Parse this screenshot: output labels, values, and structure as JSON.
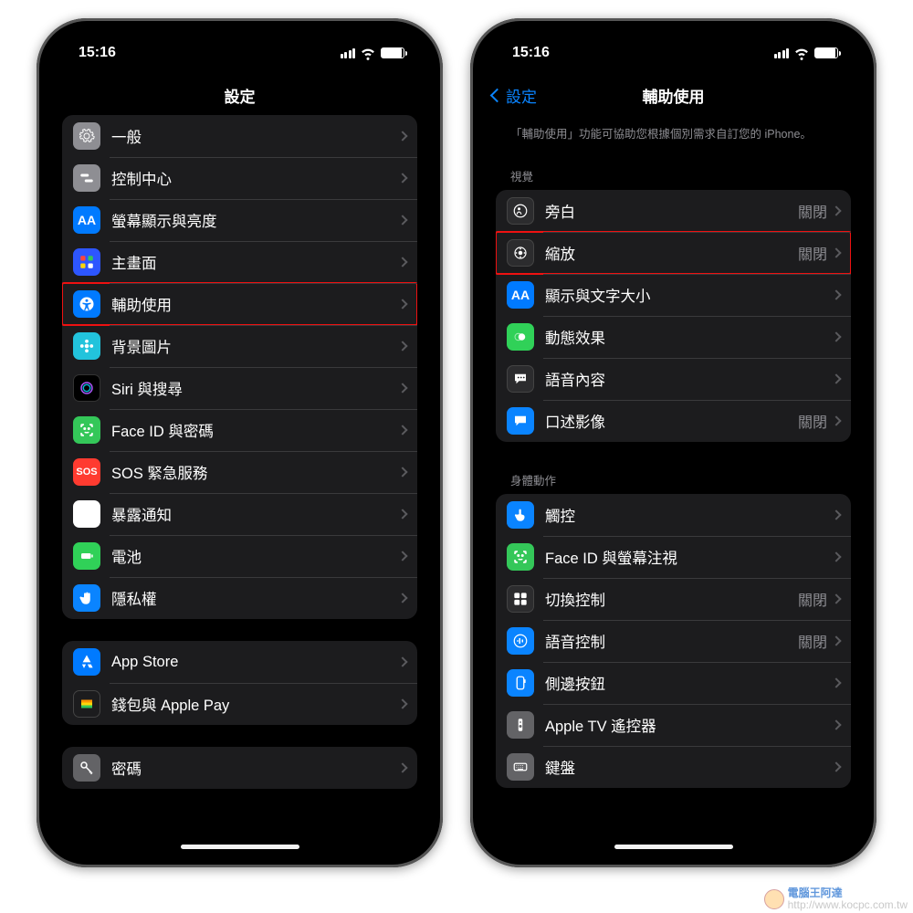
{
  "status": {
    "time": "15:16"
  },
  "left": {
    "title": "設定",
    "groups": [
      {
        "rows": [
          {
            "icon": "gear-icon",
            "label": "一般",
            "bg": "bg-gray"
          },
          {
            "icon": "switches-icon",
            "label": "控制中心",
            "bg": "bg-gray"
          },
          {
            "icon": "text-size-icon",
            "label": "螢幕顯示與亮度",
            "bg": "bg-blue"
          },
          {
            "icon": "grid-icon",
            "label": "主畫面",
            "bg": "bg-grid"
          },
          {
            "icon": "accessibility-icon",
            "label": "輔助使用",
            "bg": "bg-access",
            "highlight": true
          },
          {
            "icon": "flower-icon",
            "label": "背景圖片",
            "bg": "bg-teal"
          },
          {
            "icon": "siri-icon",
            "label": "Siri 與搜尋",
            "bg": "bg-black"
          },
          {
            "icon": "faceid-icon",
            "label": "Face ID 與密碼",
            "bg": "bg-green"
          },
          {
            "icon": "sos-icon",
            "label": "SOS 緊急服務",
            "bg": "bg-red",
            "text": "SOS"
          },
          {
            "icon": "exposure-icon",
            "label": "暴露通知",
            "bg": "bg-redw"
          },
          {
            "icon": "battery-icon",
            "label": "電池",
            "bg": "bg-green2"
          },
          {
            "icon": "hand-icon",
            "label": "隱私權",
            "bg": "bg-blue2"
          }
        ]
      },
      {
        "rows": [
          {
            "icon": "appstore-icon",
            "label": "App Store",
            "bg": "bg-blue"
          },
          {
            "icon": "wallet-icon",
            "label": "錢包與 Apple Pay",
            "bg": "bg-wall"
          }
        ]
      },
      {
        "rows": [
          {
            "icon": "key-icon",
            "label": "密碼",
            "bg": "bg-gray2"
          }
        ]
      }
    ]
  },
  "right": {
    "back": "設定",
    "title": "輔助使用",
    "desc": "「輔助使用」功能可協助您根據個別需求自訂您的 iPhone。",
    "sections": [
      {
        "header": "視覺",
        "rows": [
          {
            "icon": "voiceover-icon",
            "label": "旁白",
            "value": "關閉",
            "bg": "bg-dark"
          },
          {
            "icon": "zoom-icon",
            "label": "縮放",
            "value": "關閉",
            "bg": "bg-dark",
            "highlight": true
          },
          {
            "icon": "text-size-icon",
            "label": "顯示與文字大小",
            "bg": "bg-blue"
          },
          {
            "icon": "motion-icon",
            "label": "動態效果",
            "bg": "bg-green2"
          },
          {
            "icon": "speech-icon",
            "label": "語音內容",
            "bg": "bg-dark"
          },
          {
            "icon": "audio-desc-icon",
            "label": "口述影像",
            "value": "關閉",
            "bg": "bg-blue2"
          }
        ]
      },
      {
        "header": "身體動作",
        "rows": [
          {
            "icon": "touch-icon",
            "label": "觸控",
            "bg": "bg-blue2"
          },
          {
            "icon": "faceid-icon",
            "label": "Face ID 與螢幕注視",
            "bg": "bg-green"
          },
          {
            "icon": "switch-icon",
            "label": "切換控制",
            "value": "關閉",
            "bg": "bg-dark"
          },
          {
            "icon": "voice-ctrl-icon",
            "label": "語音控制",
            "value": "關閉",
            "bg": "bg-blue2"
          },
          {
            "icon": "side-btn-icon",
            "label": "側邊按鈕",
            "bg": "bg-blue2"
          },
          {
            "icon": "remote-icon",
            "label": "Apple TV 遙控器",
            "bg": "bg-gray2"
          },
          {
            "icon": "keyboard-icon",
            "label": "鍵盤",
            "bg": "bg-gray2"
          }
        ]
      }
    ]
  },
  "watermark": {
    "brand": "電腦王阿達",
    "url": "http://www.kocpc.com.tw"
  }
}
